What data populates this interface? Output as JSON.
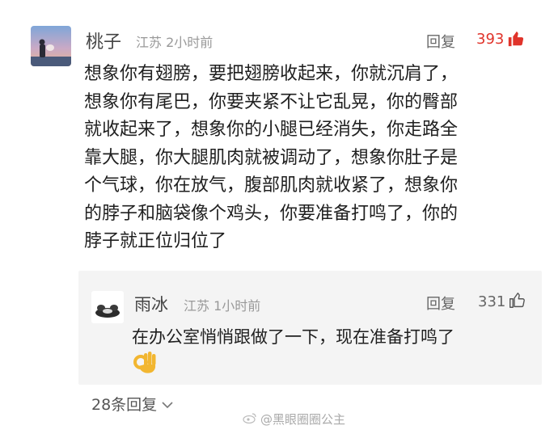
{
  "comment": {
    "username": "桃子",
    "location": "江苏",
    "time": "2小时前",
    "reply_label": "回复",
    "like_count": "393",
    "like_color": "#e0332a",
    "lines": [
      "想象你有翅膀，要把翅膀收起来，你就沉肩了，",
      "想象你有尾巴，你要夹紧不让它乱晃，你的臀部",
      "就收起来了，想象你的小腿已经消失，你走路全",
      "靠大腿，你大腿肌肉就被调动了，想象你肚子是",
      "个气球，你在放气，腹部肌肉就收紧了，想象你",
      "的脖子和脑袋像个鸡头，你要准备打鸣了，你的",
      "脖子就正位归位了"
    ]
  },
  "reply": {
    "username": "雨冰",
    "location": "江苏",
    "time": "1小时前",
    "reply_label": "回复",
    "like_count": "331",
    "text": "在办公室悄悄跟做了一下，现在准备打鸣了",
    "emoji": "ok-hand"
  },
  "more_replies_label": "28条回复",
  "watermark": "@黑眼圈圈公主",
  "icons": {
    "like": "thumbs-up-icon",
    "expand": "chevron-down-icon",
    "weibo": "weibo-logo"
  }
}
